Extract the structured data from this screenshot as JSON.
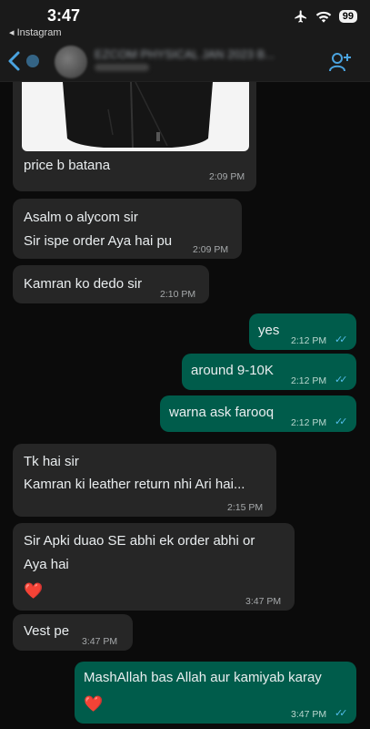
{
  "status_bar": {
    "time": "3:47",
    "back_app": "◂ Instagram",
    "battery": "99"
  },
  "header": {
    "group_name": "EZCOM PHYSICAL JAN 2023 B..."
  },
  "messages": [
    {
      "direction": "in",
      "text": "price b batana",
      "time": "2:09 PM",
      "has_image": true
    },
    {
      "direction": "in",
      "lines": [
        "Asalm o alycom sir",
        "Sir ispe order Aya hai pu"
      ],
      "time": "2:09 PM"
    },
    {
      "direction": "in",
      "text": "Kamran ko dedo sir",
      "time": "2:10 PM"
    },
    {
      "direction": "out",
      "text": "yes",
      "time": "2:12 PM"
    },
    {
      "direction": "out",
      "text": "around 9-10K",
      "time": "2:12 PM"
    },
    {
      "direction": "out",
      "text": "warna ask farooq",
      "time": "2:12 PM"
    },
    {
      "direction": "in",
      "lines": [
        "Tk hai sir",
        "Kamran ki leather return nhi Ari hai..."
      ],
      "time": "2:15 PM"
    },
    {
      "direction": "in",
      "lines": [
        "Sir Apki duao SE abhi ek order abhi or",
        "Aya hai"
      ],
      "emoji": "❤️",
      "time": "3:47 PM"
    },
    {
      "direction": "in",
      "text": "Vest pe",
      "time": "3:47 PM"
    },
    {
      "direction": "out",
      "text": "MashAllah bas Allah aur kamiyab karay",
      "emoji": "❤️",
      "time": "3:47 PM"
    }
  ],
  "icons": {
    "back": "chevron-left-icon",
    "add_contact": "add-person-icon",
    "airplane": "airplane-icon",
    "wifi": "wifi-icon",
    "read_receipt": "double-check-icon"
  },
  "colors": {
    "incoming_bubble": "#262626",
    "outgoing_bubble": "#005c4b",
    "read_tick": "#53bdeb",
    "background": "#0b0b0b"
  }
}
